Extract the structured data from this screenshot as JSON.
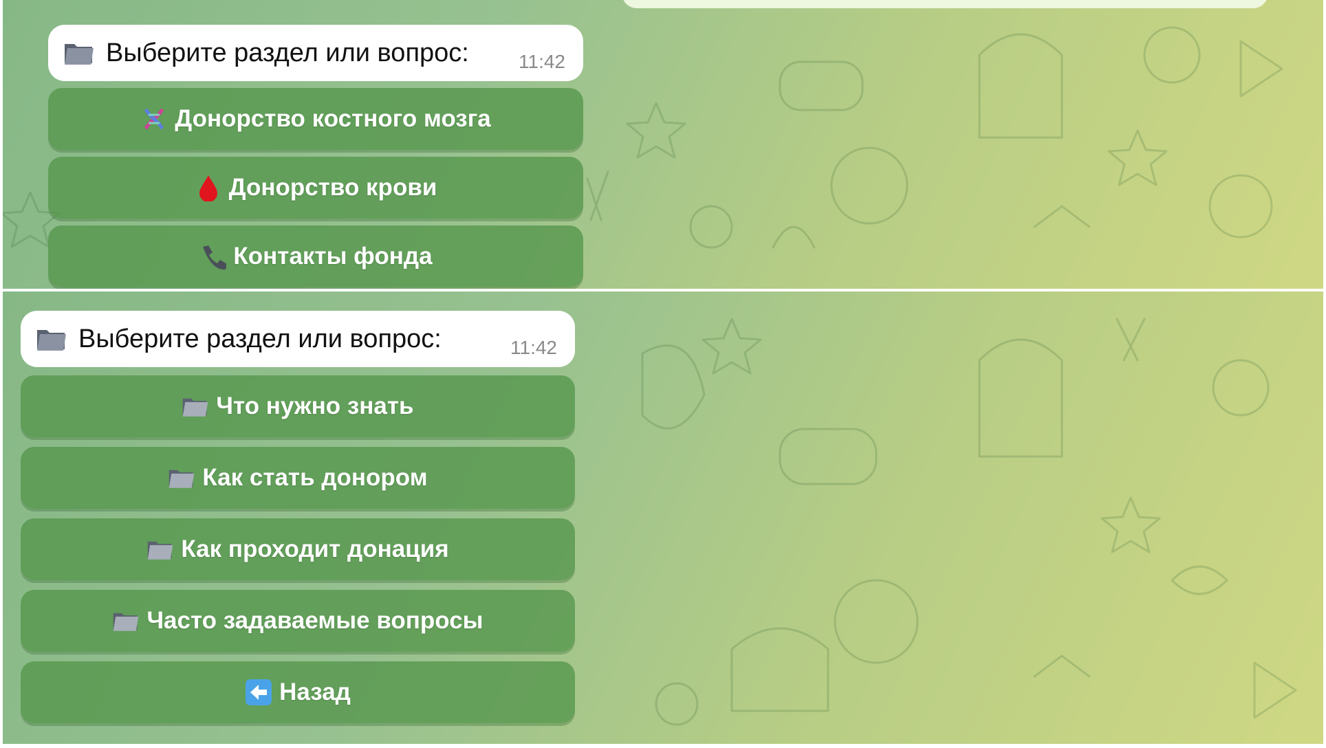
{
  "top_section": {
    "message": {
      "text": "Выберите раздел или вопрос:",
      "time": "11:42",
      "icon": "folder-icon"
    },
    "buttons": [
      {
        "label": "Донорство костного мозга",
        "icon": "dna-icon"
      },
      {
        "label": "Донорство крови",
        "icon": "blood-drop-icon"
      },
      {
        "label": "Контакты фонда",
        "icon": "telephone-icon"
      }
    ]
  },
  "bottom_section": {
    "message": {
      "text": "Выберите раздел или вопрос:",
      "time": "11:42",
      "icon": "folder-icon"
    },
    "buttons": [
      {
        "label": "Что нужно знать",
        "icon": "folder-icon"
      },
      {
        "label": "Как стать донором",
        "icon": "folder-icon"
      },
      {
        "label": "Как проходит донация",
        "icon": "folder-icon"
      },
      {
        "label": "Часто задаваемые вопросы",
        "icon": "folder-icon"
      },
      {
        "label": "Назад",
        "icon": "back-arrow-icon"
      }
    ]
  },
  "colors": {
    "button_bg": "#5f9f55",
    "bubble": "#ffffff",
    "time": "#8a8a8a"
  }
}
